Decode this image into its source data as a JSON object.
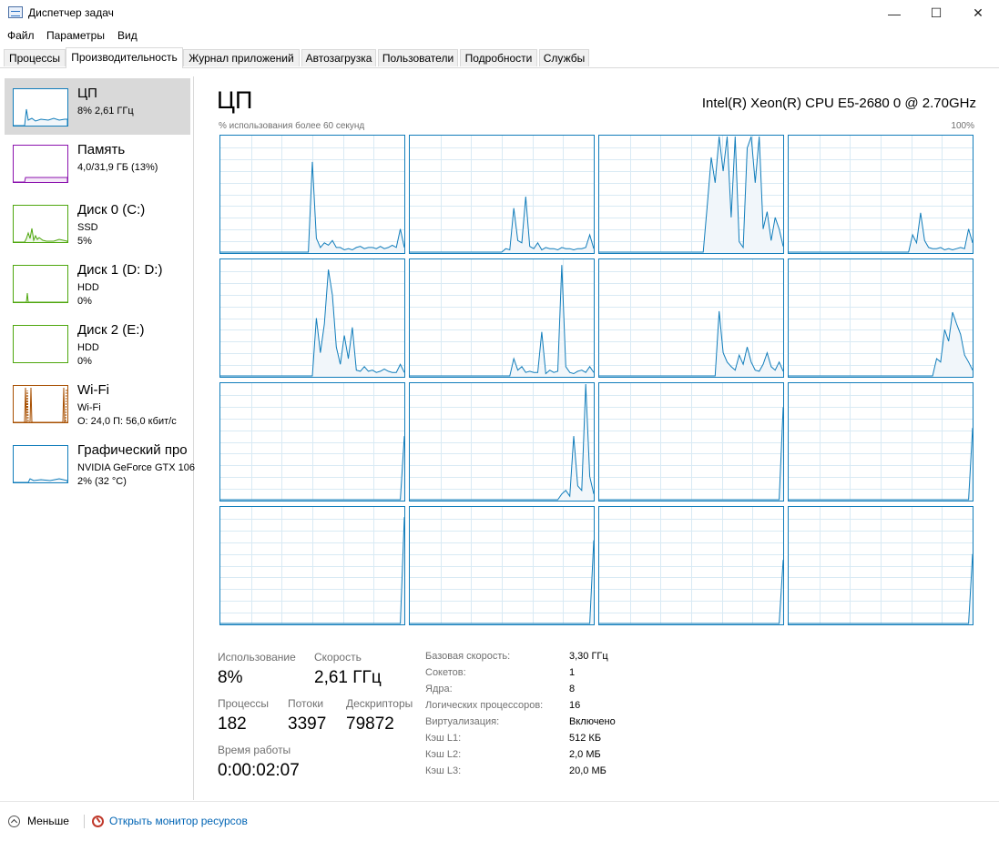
{
  "window": {
    "title": "Диспетчер задач"
  },
  "window_buttons": {
    "minimize": "—",
    "maximize": "☐",
    "close": "✕"
  },
  "menu": [
    "Файл",
    "Параметры",
    "Вид"
  ],
  "tabs": [
    "Процессы",
    "Производительность",
    "Журнал приложений",
    "Автозагрузка",
    "Пользователи",
    "Подробности",
    "Службы"
  ],
  "active_tab": "Производительность",
  "sidebar": {
    "items": [
      {
        "title": "ЦП",
        "line2": "8% 2,61 ГГц",
        "line3": "",
        "color": "#117dbb"
      },
      {
        "title": "Память",
        "line2": "4,0/31,9 ГБ (13%)",
        "line3": "",
        "color": "#8b12ae"
      },
      {
        "title": "Диск 0 (C:)",
        "line2": "SSD",
        "line3": "5%",
        "color": "#4da60c"
      },
      {
        "title": "Диск 1 (D: D:)",
        "line2": "HDD",
        "line3": "0%",
        "color": "#4da60c"
      },
      {
        "title": "Диск 2 (E:)",
        "line2": "HDD",
        "line3": "0%",
        "color": "#4da60c"
      },
      {
        "title": "Wi-Fi",
        "line2": "Wi-Fi",
        "line3": "О: 24,0  П: 56,0 кбит/с",
        "color": "#a74f01"
      },
      {
        "title": "Графический про",
        "line2": "NVIDIA GeForce GTX 106",
        "line3": "2% (32 °C)",
        "color": "#117dbb"
      }
    ]
  },
  "main": {
    "title": "ЦП",
    "cpu_name": "Intel(R) Xeon(R) CPU E5-2680 0 @ 2.70GHz",
    "usage_label": "% использования более 60 секунд",
    "max_label": "100%"
  },
  "stats": {
    "usage_label": "Использование",
    "usage_value": "8%",
    "speed_label": "Скорость",
    "speed_value": "2,61 ГГц",
    "processes_label": "Процессы",
    "processes_value": "182",
    "threads_label": "Потоки",
    "threads_value": "3397",
    "handles_label": "Дескрипторы",
    "handles_value": "79872",
    "uptime_label": "Время работы",
    "uptime_value": "0:00:02:07"
  },
  "details": [
    {
      "key": "Базовая скорость:",
      "value": "3,30 ГГц"
    },
    {
      "key": "Сокетов:",
      "value": "1"
    },
    {
      "key": "Ядра:",
      "value": "8"
    },
    {
      "key": "Логических процессоров:",
      "value": "16"
    },
    {
      "key": "Виртуализация:",
      "value": "Включено"
    },
    {
      "key": "Кэш L1:",
      "value": "512 КБ"
    },
    {
      "key": "Кэш L2:",
      "value": "2,0 МБ"
    },
    {
      "key": "Кэш L3:",
      "value": "20,0 МБ"
    }
  ],
  "footer": {
    "fewer_label": "Меньше",
    "resmon_label": "Открыть монитор ресурсов"
  },
  "colors": {
    "accent": "#117dbb",
    "fill": "#f1f6fa",
    "grid": "#d9eaf4"
  },
  "icons": [
    "task-manager-app-icon",
    "chevron-up-icon",
    "resource-monitor-icon"
  ],
  "chart_data": {
    "type": "area",
    "y_range": [
      0,
      100
    ],
    "x_range_seconds": 60,
    "series": [
      {
        "values": [
          0,
          0,
          0,
          0,
          0,
          0,
          0,
          0,
          0,
          0,
          0,
          0,
          0,
          0,
          0,
          0,
          0,
          0,
          0,
          0,
          0,
          0,
          0,
          78,
          12,
          4,
          8,
          6,
          10,
          4,
          4,
          2,
          3,
          2,
          4,
          5,
          3,
          4,
          4,
          3,
          5,
          3,
          4,
          6,
          4,
          20,
          4
        ]
      },
      {
        "values": [
          0,
          0,
          0,
          0,
          0,
          0,
          0,
          0,
          0,
          0,
          0,
          0,
          0,
          0,
          0,
          0,
          0,
          0,
          0,
          0,
          0,
          0,
          0,
          0,
          3,
          2,
          38,
          10,
          8,
          48,
          5,
          3,
          8,
          2,
          4,
          3,
          3,
          2,
          4,
          3,
          3,
          2,
          3,
          3,
          4,
          15,
          3
        ]
      },
      {
        "values": [
          0,
          0,
          0,
          0,
          0,
          0,
          0,
          0,
          0,
          0,
          0,
          0,
          0,
          0,
          0,
          0,
          0,
          0,
          0,
          0,
          0,
          0,
          0,
          0,
          0,
          0,
          0,
          40,
          82,
          60,
          100,
          70,
          100,
          30,
          100,
          9,
          4,
          90,
          100,
          60,
          100,
          20,
          35,
          10,
          30,
          20,
          5
        ]
      },
      {
        "values": [
          0,
          0,
          0,
          0,
          0,
          0,
          0,
          0,
          0,
          0,
          0,
          0,
          0,
          0,
          0,
          0,
          0,
          0,
          0,
          0,
          0,
          0,
          0,
          0,
          0,
          0,
          0,
          0,
          0,
          0,
          0,
          15,
          8,
          34,
          10,
          4,
          3,
          3,
          4,
          2,
          3,
          2,
          3,
          4,
          3,
          20,
          8
        ]
      },
      {
        "values": [
          0,
          0,
          0,
          0,
          0,
          0,
          0,
          0,
          0,
          0,
          0,
          0,
          0,
          0,
          0,
          0,
          0,
          0,
          0,
          0,
          0,
          0,
          0,
          0,
          50,
          20,
          45,
          92,
          70,
          25,
          10,
          35,
          15,
          42,
          5,
          4,
          8,
          4,
          5,
          3,
          4,
          6,
          4,
          3,
          3,
          10,
          3
        ]
      },
      {
        "values": [
          0,
          0,
          0,
          0,
          0,
          0,
          0,
          0,
          0,
          0,
          0,
          0,
          0,
          0,
          0,
          0,
          0,
          0,
          0,
          0,
          0,
          0,
          0,
          0,
          0,
          0,
          15,
          5,
          8,
          3,
          4,
          3,
          3,
          38,
          2,
          5,
          3,
          4,
          96,
          8,
          3,
          2,
          4,
          5,
          3,
          8,
          3
        ]
      },
      {
        "values": [
          0,
          0,
          0,
          0,
          0,
          0,
          0,
          0,
          0,
          0,
          0,
          0,
          0,
          0,
          0,
          0,
          0,
          0,
          0,
          0,
          0,
          0,
          0,
          0,
          0,
          0,
          0,
          0,
          0,
          0,
          56,
          20,
          12,
          8,
          5,
          18,
          10,
          25,
          12,
          5,
          4,
          10,
          20,
          8,
          5,
          12,
          4
        ]
      },
      {
        "values": [
          0,
          0,
          0,
          0,
          0,
          0,
          0,
          0,
          0,
          0,
          0,
          0,
          0,
          0,
          0,
          0,
          0,
          0,
          0,
          0,
          0,
          0,
          0,
          0,
          0,
          0,
          0,
          0,
          0,
          0,
          0,
          0,
          0,
          0,
          0,
          0,
          0,
          15,
          12,
          40,
          30,
          55,
          45,
          36,
          18,
          12,
          5
        ]
      },
      {
        "values": [
          0,
          0,
          0,
          0,
          0,
          0,
          0,
          0,
          0,
          0,
          0,
          0,
          0,
          0,
          0,
          0,
          0,
          0,
          0,
          0,
          0,
          0,
          0,
          0,
          0,
          0,
          0,
          0,
          0,
          0,
          0,
          0,
          0,
          0,
          0,
          0,
          0,
          0,
          0,
          0,
          0,
          0,
          0,
          0,
          0,
          0,
          55
        ]
      },
      {
        "values": [
          0,
          0,
          0,
          0,
          0,
          0,
          0,
          0,
          0,
          0,
          0,
          0,
          0,
          0,
          0,
          0,
          0,
          0,
          0,
          0,
          0,
          0,
          0,
          0,
          0,
          0,
          0,
          0,
          0,
          0,
          0,
          0,
          0,
          0,
          0,
          0,
          0,
          0,
          5,
          8,
          3,
          55,
          12,
          8,
          100,
          20,
          5
        ]
      },
      {
        "values": [
          0,
          0,
          0,
          0,
          0,
          0,
          0,
          0,
          0,
          0,
          0,
          0,
          0,
          0,
          0,
          0,
          0,
          0,
          0,
          0,
          0,
          0,
          0,
          0,
          0,
          0,
          0,
          0,
          0,
          0,
          0,
          0,
          0,
          0,
          0,
          0,
          0,
          0,
          0,
          0,
          0,
          0,
          0,
          0,
          0,
          0,
          80
        ]
      },
      {
        "values": [
          0,
          0,
          0,
          0,
          0,
          0,
          0,
          0,
          0,
          0,
          0,
          0,
          0,
          0,
          0,
          0,
          0,
          0,
          0,
          0,
          0,
          0,
          0,
          0,
          0,
          0,
          0,
          0,
          0,
          0,
          0,
          0,
          0,
          0,
          0,
          0,
          0,
          0,
          0,
          0,
          0,
          0,
          0,
          0,
          0,
          0,
          62
        ]
      },
      {
        "values": [
          0,
          0,
          0,
          0,
          0,
          0,
          0,
          0,
          0,
          0,
          0,
          0,
          0,
          0,
          0,
          0,
          0,
          0,
          0,
          0,
          0,
          0,
          0,
          0,
          0,
          0,
          0,
          0,
          0,
          0,
          0,
          0,
          0,
          0,
          0,
          0,
          0,
          0,
          0,
          0,
          0,
          0,
          0,
          0,
          0,
          0,
          92
        ]
      },
      {
        "values": [
          0,
          0,
          0,
          0,
          0,
          0,
          0,
          0,
          0,
          0,
          0,
          0,
          0,
          0,
          0,
          0,
          0,
          0,
          0,
          0,
          0,
          0,
          0,
          0,
          0,
          0,
          0,
          0,
          0,
          0,
          0,
          0,
          0,
          0,
          0,
          0,
          0,
          0,
          0,
          0,
          0,
          0,
          0,
          0,
          0,
          0,
          72
        ]
      },
      {
        "values": [
          0,
          0,
          0,
          0,
          0,
          0,
          0,
          0,
          0,
          0,
          0,
          0,
          0,
          0,
          0,
          0,
          0,
          0,
          0,
          0,
          0,
          0,
          0,
          0,
          0,
          0,
          0,
          0,
          0,
          0,
          0,
          0,
          0,
          0,
          0,
          0,
          0,
          0,
          0,
          0,
          0,
          0,
          0,
          0,
          0,
          0,
          55
        ]
      },
      {
        "values": [
          0,
          0,
          0,
          0,
          0,
          0,
          0,
          0,
          0,
          0,
          0,
          0,
          0,
          0,
          0,
          0,
          0,
          0,
          0,
          0,
          0,
          0,
          0,
          0,
          0,
          0,
          0,
          0,
          0,
          0,
          0,
          0,
          0,
          0,
          0,
          0,
          0,
          0,
          0,
          0,
          0,
          0,
          0,
          0,
          0,
          0,
          60
        ]
      }
    ]
  }
}
